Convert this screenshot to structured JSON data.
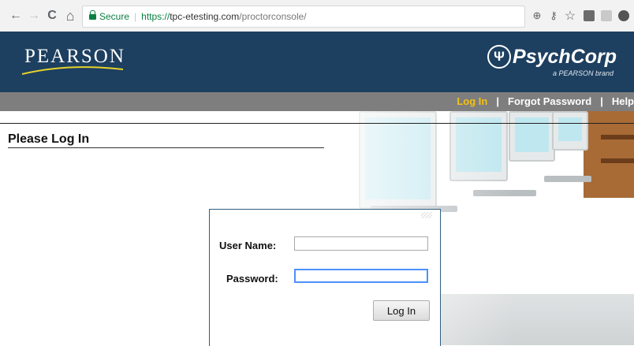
{
  "browser": {
    "secure_label": "Secure",
    "url_scheme": "https://",
    "url_domain": "tpc-etesting.com",
    "url_path": "/proctorconsole/",
    "back_glyph": "←",
    "forward_glyph": "→",
    "reload_glyph": "C",
    "home_glyph": "⌂",
    "zoom_glyph": "⊕",
    "key_glyph": "⚷",
    "star_glyph": "☆"
  },
  "header": {
    "brand": "PEARSON",
    "partner_brand": "PsychCorp",
    "partner_symbol": "Ψ",
    "partner_tagline": "a PEARSON brand",
    "colors": {
      "header_bg": "#1d3f60",
      "nav_bg": "#7e7e7e",
      "active_link": "#f3c018"
    }
  },
  "nav": {
    "login": "Log In",
    "separator": "|",
    "forgot_password": "Forgot Password",
    "help": "Help"
  },
  "main": {
    "title": "Please Log In"
  },
  "login_form": {
    "username_label": "User Name:",
    "username_value": "",
    "password_label": "Password:",
    "password_value": "",
    "submit_label": "Log In"
  }
}
